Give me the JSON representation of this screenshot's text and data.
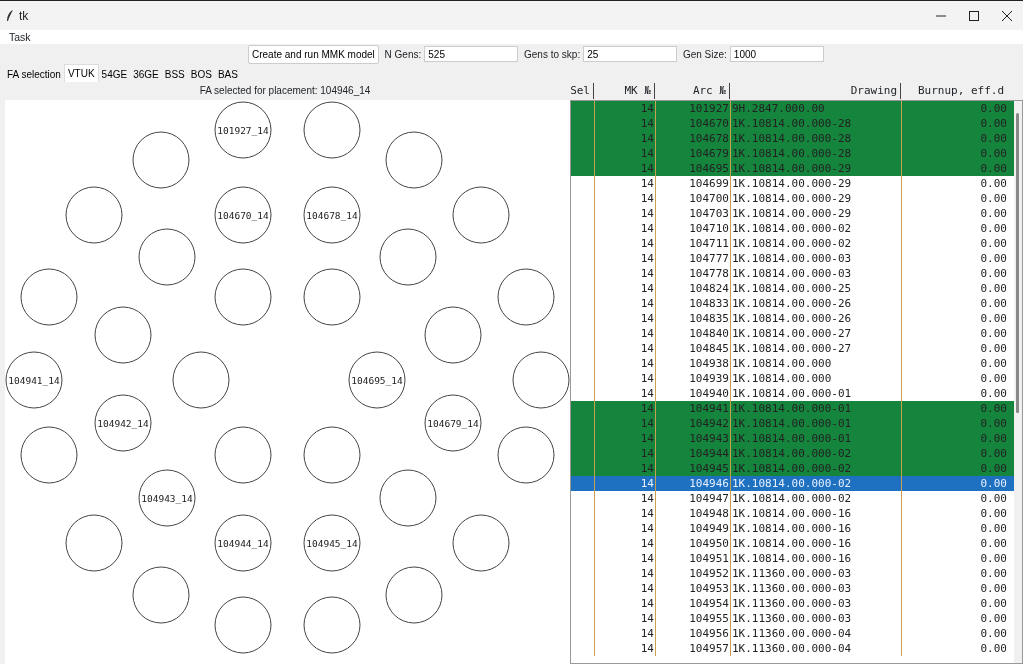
{
  "window": {
    "title": "tk"
  },
  "menu": [
    "Task"
  ],
  "toolbar": {
    "run_button": "Create and run MMK model",
    "fields": [
      {
        "label": "N Gens:",
        "value": "525"
      },
      {
        "label": "Gens to skp:",
        "value": "25"
      },
      {
        "label": "Gen Size:",
        "value": "1000"
      }
    ]
  },
  "tabs": [
    {
      "label": "FA selection",
      "selected": false
    },
    {
      "label": "VTUK",
      "selected": true
    },
    {
      "label": "54GE",
      "selected": false
    },
    {
      "label": "36GE",
      "selected": false
    },
    {
      "label": "BSS",
      "selected": false
    },
    {
      "label": "BOS",
      "selected": false
    },
    {
      "label": "BAS",
      "selected": false
    }
  ],
  "placement_label": "FA selected for placement: 104946_14",
  "core_positions": [
    {
      "kind": "assembly",
      "label": "101927_14"
    },
    {
      "kind": "empty"
    },
    {
      "kind": "empty"
    },
    {
      "kind": "empty"
    },
    {
      "kind": "empty"
    },
    {
      "kind": "assembly",
      "label": "104670_14"
    },
    {
      "kind": "assembly",
      "label": "104678_14"
    },
    {
      "kind": "empty"
    },
    {
      "kind": "empty"
    },
    {
      "kind": "empty"
    },
    {
      "kind": "empty"
    },
    {
      "kind": "empty"
    },
    {
      "kind": "empty"
    },
    {
      "kind": "empty"
    },
    {
      "kind": "empty"
    },
    {
      "kind": "empty"
    },
    {
      "kind": "assembly",
      "label": "104941_14"
    },
    {
      "kind": "empty"
    },
    {
      "kind": "assembly",
      "label": "104695_14"
    },
    {
      "kind": "empty"
    },
    {
      "kind": "assembly",
      "label": "104942_14"
    },
    {
      "kind": "assembly",
      "label": "104679_14"
    },
    {
      "kind": "empty"
    },
    {
      "kind": "empty"
    },
    {
      "kind": "empty"
    },
    {
      "kind": "empty"
    },
    {
      "kind": "assembly",
      "label": "104943_14"
    },
    {
      "kind": "empty"
    },
    {
      "kind": "empty"
    },
    {
      "kind": "assembly",
      "label": "104944_14"
    },
    {
      "kind": "assembly",
      "label": "104945_14"
    },
    {
      "kind": "empty"
    },
    {
      "kind": "empty"
    },
    {
      "kind": "empty"
    },
    {
      "kind": "empty"
    },
    {
      "kind": "empty"
    }
  ],
  "table": {
    "columns": [
      "Sel",
      "MK №",
      "Arc №",
      "Drawing",
      "Burnup, eff.d"
    ],
    "rows": [
      {
        "mk": "14",
        "arc": "101927",
        "drawing": "9H.2847.000.00",
        "burnup": "0.00",
        "placed": true,
        "selected": false
      },
      {
        "mk": "14",
        "arc": "104670",
        "drawing": "1K.10814.00.000-28",
        "burnup": "0.00",
        "placed": true,
        "selected": false
      },
      {
        "mk": "14",
        "arc": "104678",
        "drawing": "1K.10814.00.000-28",
        "burnup": "0.00",
        "placed": true,
        "selected": false
      },
      {
        "mk": "14",
        "arc": "104679",
        "drawing": "1K.10814.00.000-28",
        "burnup": "0.00",
        "placed": true,
        "selected": false
      },
      {
        "mk": "14",
        "arc": "104695",
        "drawing": "1K.10814.00.000-29",
        "burnup": "0.00",
        "placed": true,
        "selected": false
      },
      {
        "mk": "14",
        "arc": "104699",
        "drawing": "1K.10814.00.000-29",
        "burnup": "0.00",
        "placed": false,
        "selected": false
      },
      {
        "mk": "14",
        "arc": "104700",
        "drawing": "1K.10814.00.000-29",
        "burnup": "0.00",
        "placed": false,
        "selected": false
      },
      {
        "mk": "14",
        "arc": "104703",
        "drawing": "1K.10814.00.000-29",
        "burnup": "0.00",
        "placed": false,
        "selected": false
      },
      {
        "mk": "14",
        "arc": "104710",
        "drawing": "1K.10814.00.000-02",
        "burnup": "0.00",
        "placed": false,
        "selected": false
      },
      {
        "mk": "14",
        "arc": "104711",
        "drawing": "1K.10814.00.000-02",
        "burnup": "0.00",
        "placed": false,
        "selected": false
      },
      {
        "mk": "14",
        "arc": "104777",
        "drawing": "1K.10814.00.000-03",
        "burnup": "0.00",
        "placed": false,
        "selected": false
      },
      {
        "mk": "14",
        "arc": "104778",
        "drawing": "1K.10814.00.000-03",
        "burnup": "0.00",
        "placed": false,
        "selected": false
      },
      {
        "mk": "14",
        "arc": "104824",
        "drawing": "1K.10814.00.000-25",
        "burnup": "0.00",
        "placed": false,
        "selected": false
      },
      {
        "mk": "14",
        "arc": "104833",
        "drawing": "1K.10814.00.000-26",
        "burnup": "0.00",
        "placed": false,
        "selected": false
      },
      {
        "mk": "14",
        "arc": "104835",
        "drawing": "1K.10814.00.000-26",
        "burnup": "0.00",
        "placed": false,
        "selected": false
      },
      {
        "mk": "14",
        "arc": "104840",
        "drawing": "1K.10814.00.000-27",
        "burnup": "0.00",
        "placed": false,
        "selected": false
      },
      {
        "mk": "14",
        "arc": "104845",
        "drawing": "1K.10814.00.000-27",
        "burnup": "0.00",
        "placed": false,
        "selected": false
      },
      {
        "mk": "14",
        "arc": "104938",
        "drawing": "1K.10814.00.000",
        "burnup": "0.00",
        "placed": false,
        "selected": false
      },
      {
        "mk": "14",
        "arc": "104939",
        "drawing": "1K.10814.00.000",
        "burnup": "0.00",
        "placed": false,
        "selected": false
      },
      {
        "mk": "14",
        "arc": "104940",
        "drawing": "1K.10814.00.000-01",
        "burnup": "0.00",
        "placed": false,
        "selected": false
      },
      {
        "mk": "14",
        "arc": "104941",
        "drawing": "1K.10814.00.000-01",
        "burnup": "0.00",
        "placed": true,
        "selected": false
      },
      {
        "mk": "14",
        "arc": "104942",
        "drawing": "1K.10814.00.000-01",
        "burnup": "0.00",
        "placed": true,
        "selected": false
      },
      {
        "mk": "14",
        "arc": "104943",
        "drawing": "1K.10814.00.000-01",
        "burnup": "0.00",
        "placed": true,
        "selected": false
      },
      {
        "mk": "14",
        "arc": "104944",
        "drawing": "1K.10814.00.000-02",
        "burnup": "0.00",
        "placed": true,
        "selected": false
      },
      {
        "mk": "14",
        "arc": "104945",
        "drawing": "1K.10814.00.000-02",
        "burnup": "0.00",
        "placed": true,
        "selected": false
      },
      {
        "mk": "14",
        "arc": "104946",
        "drawing": "1K.10814.00.000-02",
        "burnup": "0.00",
        "placed": false,
        "selected": true
      },
      {
        "mk": "14",
        "arc": "104947",
        "drawing": "1K.10814.00.000-02",
        "burnup": "0.00",
        "placed": false,
        "selected": false
      },
      {
        "mk": "14",
        "arc": "104948",
        "drawing": "1K.10814.00.000-16",
        "burnup": "0.00",
        "placed": false,
        "selected": false
      },
      {
        "mk": "14",
        "arc": "104949",
        "drawing": "1K.10814.00.000-16",
        "burnup": "0.00",
        "placed": false,
        "selected": false
      },
      {
        "mk": "14",
        "arc": "104950",
        "drawing": "1K.10814.00.000-16",
        "burnup": "0.00",
        "placed": false,
        "selected": false
      },
      {
        "mk": "14",
        "arc": "104951",
        "drawing": "1K.10814.00.000-16",
        "burnup": "0.00",
        "placed": false,
        "selected": false
      },
      {
        "mk": "14",
        "arc": "104952",
        "drawing": "1K.11360.00.000-03",
        "burnup": "0.00",
        "placed": false,
        "selected": false
      },
      {
        "mk": "14",
        "arc": "104953",
        "drawing": "1K.11360.00.000-03",
        "burnup": "0.00",
        "placed": false,
        "selected": false
      },
      {
        "mk": "14",
        "arc": "104954",
        "drawing": "1K.11360.00.000-03",
        "burnup": "0.00",
        "placed": false,
        "selected": false
      },
      {
        "mk": "14",
        "arc": "104955",
        "drawing": "1K.11360.00.000-03",
        "burnup": "0.00",
        "placed": false,
        "selected": false
      },
      {
        "mk": "14",
        "arc": "104956",
        "drawing": "1K.11360.00.000-04",
        "burnup": "0.00",
        "placed": false,
        "selected": false
      },
      {
        "mk": "14",
        "arc": "104957",
        "drawing": "1K.11360.00.000-04",
        "burnup": "0.00",
        "placed": false,
        "selected": false
      }
    ]
  }
}
